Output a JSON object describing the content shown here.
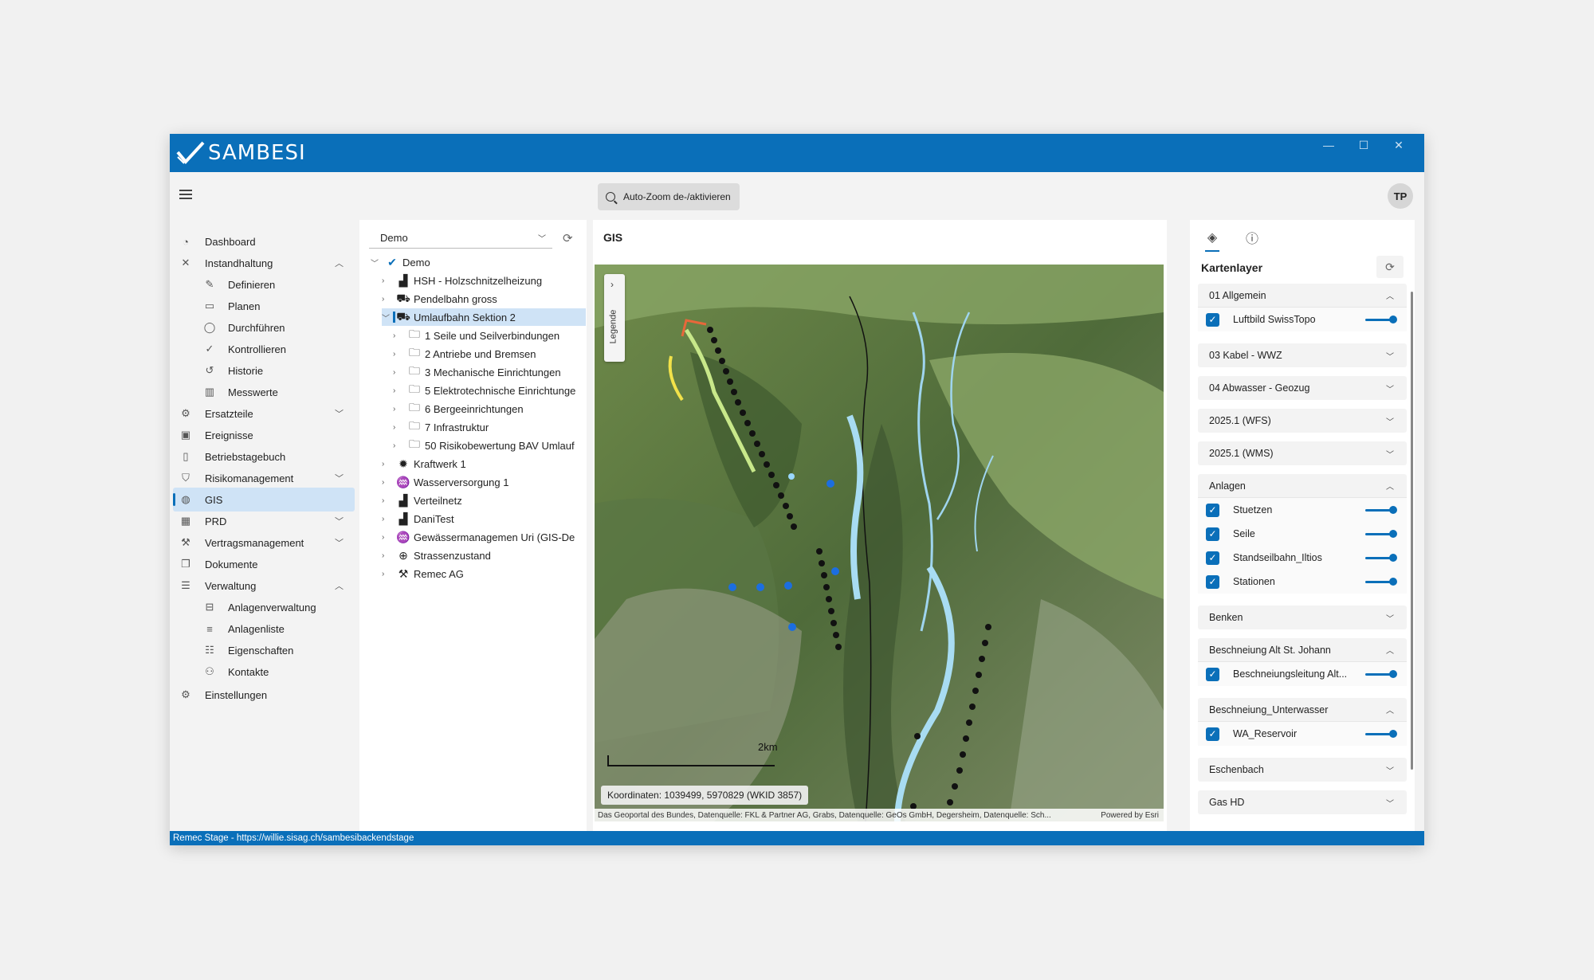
{
  "app": {
    "name": "SAMBESI"
  },
  "window_controls": {
    "minimize": "—",
    "maximize": "☐",
    "close": "✕"
  },
  "toolbar": {
    "autozoom_label": "Auto-Zoom de-/aktivieren",
    "user_initials": "TP"
  },
  "sidebar": {
    "items": [
      {
        "label": "Dashboard",
        "icon": "dashboard-icon",
        "glyph": "◔"
      },
      {
        "label": "Instandhaltung",
        "icon": "tools-icon",
        "glyph": "✕",
        "chevron": "︿"
      },
      {
        "label": "Definieren",
        "icon": "pencil-icon",
        "glyph": "✎"
      },
      {
        "label": "Planen",
        "icon": "calendar-icon",
        "glyph": "▭"
      },
      {
        "label": "Durchführen",
        "icon": "check-circle-icon",
        "glyph": "◯"
      },
      {
        "label": "Kontrollieren",
        "icon": "check-icon",
        "glyph": "✓"
      },
      {
        "label": "Historie",
        "icon": "history-icon",
        "glyph": "↺"
      },
      {
        "label": "Messwerte",
        "icon": "chart-icon",
        "glyph": "▥"
      },
      {
        "label": "Ersatzteile",
        "icon": "gears-icon",
        "glyph": "⚙",
        "chevron": "﹀"
      },
      {
        "label": "Ereignisse",
        "icon": "event-icon",
        "glyph": "▣"
      },
      {
        "label": "Betriebstagebuch",
        "icon": "book-icon",
        "glyph": "▯"
      },
      {
        "label": "Risikomanagement",
        "icon": "shield-icon",
        "glyph": "⛉",
        "chevron": "﹀"
      },
      {
        "label": "GIS",
        "icon": "globe-icon",
        "glyph": "◍"
      },
      {
        "label": "PRD",
        "icon": "building-icon",
        "glyph": "▦",
        "chevron": "﹀"
      },
      {
        "label": "Vertragsmanagement",
        "icon": "gavel-icon",
        "glyph": "⚒",
        "chevron": "﹀"
      },
      {
        "label": "Dokumente",
        "icon": "documents-icon",
        "glyph": "❐"
      },
      {
        "label": "Verwaltung",
        "icon": "database-icon",
        "glyph": "☰",
        "chevron": "︿"
      },
      {
        "label": "Anlagenverwaltung",
        "icon": "hierarchy-icon",
        "glyph": "⊟"
      },
      {
        "label": "Anlagenliste",
        "icon": "list-icon",
        "glyph": "≡"
      },
      {
        "label": "Eigenschaften",
        "icon": "properties-icon",
        "glyph": "☷"
      },
      {
        "label": "Kontakte",
        "icon": "contacts-icon",
        "glyph": "⚇"
      },
      {
        "label": "Einstellungen",
        "icon": "gear-icon",
        "glyph": "⚙"
      }
    ]
  },
  "tree": {
    "selector_value": "Demo",
    "nodes": [
      {
        "label": "Demo",
        "toggle": "﹀",
        "icon": "check-logo-icon",
        "glyph": "✔"
      },
      {
        "label": "HSH - Holzschnitzelheizung",
        "toggle": "›",
        "icon": "factory-icon",
        "glyph": "▟"
      },
      {
        "label": "Pendelbahn gross",
        "toggle": "›",
        "icon": "cable-car-icon",
        "glyph": "⛟"
      },
      {
        "label": "Umlaufbahn Sektion 2",
        "toggle": "﹀",
        "icon": "gondola-icon",
        "glyph": "⛟"
      },
      {
        "label": "1 Seile und Seilverbindungen",
        "toggle": "›",
        "icon": "folder-icon",
        "glyph": "🗀"
      },
      {
        "label": "2 Antriebe und Bremsen",
        "toggle": "›",
        "icon": "folder-icon",
        "glyph": "🗀"
      },
      {
        "label": "3 Mechanische Einrichtungen",
        "toggle": "›",
        "icon": "folder-icon",
        "glyph": "🗀"
      },
      {
        "label": "5 Elektrotechnische Einrichtunge",
        "toggle": "›",
        "icon": "folder-icon",
        "glyph": "🗀"
      },
      {
        "label": "6 Bergeeinrichtungen",
        "toggle": "›",
        "icon": "folder-icon",
        "glyph": "🗀"
      },
      {
        "label": "7 Infrastruktur",
        "toggle": "›",
        "icon": "folder-icon",
        "glyph": "🗀"
      },
      {
        "label": "50 Risikobewertung BAV Umlauf",
        "toggle": "›",
        "icon": "folder-icon",
        "glyph": "🗀"
      },
      {
        "label": "Kraftwerk 1",
        "toggle": "›",
        "icon": "power-plant-icon",
        "glyph": "✹"
      },
      {
        "label": "Wasserversorgung 1",
        "toggle": "›",
        "icon": "water-icon",
        "glyph": "♒"
      },
      {
        "label": "Verteilnetz",
        "toggle": "›",
        "icon": "factory-icon",
        "glyph": "▟"
      },
      {
        "label": "DaniTest",
        "toggle": "›",
        "icon": "factory-icon",
        "glyph": "▟"
      },
      {
        "label": "Gewässermanagemen Uri  (GIS-De",
        "toggle": "›",
        "icon": "water-icon",
        "glyph": "♒"
      },
      {
        "label": "Strassenzustand",
        "toggle": "›",
        "icon": "road-icon",
        "glyph": "⊕"
      },
      {
        "label": "Remec AG",
        "toggle": "›",
        "icon": "tools-icon",
        "glyph": "⚒"
      }
    ]
  },
  "map": {
    "title": "GIS",
    "legend_label": "Legende",
    "legend_arrow": "›",
    "scale_label": "2km",
    "coordinates": "Koordinaten: 1039499, 5970829 (WKID 3857)",
    "attribution": "Das Geoportal des Bundes, Datenquelle: FKL & Partner AG, Grabs, Datenquelle: GeOs GmbH, Degersheim, Datenquelle: Sch...",
    "powered_by": "Powered by Esri"
  },
  "layers": {
    "title": "Kartenlayer",
    "tab_icons": [
      "layers-icon",
      "info-icon"
    ],
    "groups": [
      {
        "name": "01 Allgemein",
        "open": true,
        "layers": [
          {
            "name": "Luftbild SwissTopo",
            "checked": true,
            "opacity": 1
          }
        ]
      },
      {
        "name": "03 Kabel - WWZ",
        "open": false,
        "layers": []
      },
      {
        "name": "04 Abwasser - Geozug",
        "open": false,
        "layers": []
      },
      {
        "name": "2025.1 (WFS)",
        "open": false,
        "layers": []
      },
      {
        "name": "2025.1 (WMS)",
        "open": false,
        "layers": []
      },
      {
        "name": "Anlagen",
        "open": true,
        "layers": [
          {
            "name": "Stuetzen",
            "checked": true,
            "opacity": 1
          },
          {
            "name": "Seile",
            "checked": true,
            "opacity": 1
          },
          {
            "name": "Standseilbahn_Iltios",
            "checked": true,
            "opacity": 1
          },
          {
            "name": "Stationen",
            "checked": true,
            "opacity": 1
          }
        ]
      },
      {
        "name": "Benken",
        "open": false,
        "layers": []
      },
      {
        "name": "Beschneiung Alt St. Johann",
        "open": true,
        "layers": [
          {
            "name": "Beschneiungsleitung Alt...",
            "checked": true,
            "opacity": 1
          }
        ]
      },
      {
        "name": "Beschneiung_Unterwasser",
        "open": true,
        "layers": [
          {
            "name": "WA_Reservoir",
            "checked": true,
            "opacity": 1
          }
        ]
      },
      {
        "name": "Eschenbach",
        "open": false,
        "layers": []
      },
      {
        "name": "Gas HD",
        "open": false,
        "layers": []
      }
    ]
  },
  "status": {
    "text": "Remec Stage - https://willie.sisag.ch/sambesibackendstage"
  },
  "colors": {
    "brand": "#0a6fb9",
    "selection": "#cfe3f6"
  }
}
